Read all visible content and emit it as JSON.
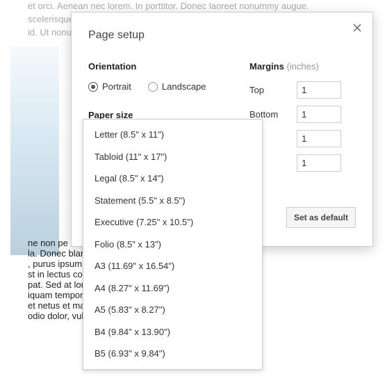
{
  "bg": {
    "line1": "et orci. Aenean nec lorem. In porttitor. Donec laoreet nonummy augue.",
    "line2": "scelerisque",
    "line3": "id. Ut nonur",
    "link1": "ne non pe",
    "link2": "la. Donec blan                                                              rit, felis et",
    "link3": ", purus ipsum p                                                            sl eget",
    "link4": "st in lectus co                                                        dui.",
    "link5": "pat. Sed at lore",
    "link6": "iquam tempor magna. Pellentesque habitant morbi",
    "link7": "et netus et malesuada fames ac turpis egestas. Nunc ac",
    "link8": "odio dolor, vulputate vel, auctor ac, accumsan id, felis."
  },
  "dialog": {
    "title": "Page setup",
    "orientation_label": "Orientation",
    "portrait": "Portrait",
    "landscape": "Landscape",
    "paper_size_label": "Paper size",
    "margins_label": "Margins",
    "margins_unit": " (inches)",
    "margin_top_label": "Top",
    "margin_bottom_label": "Bottom",
    "margin_top": "1",
    "margin_bottom": "1",
    "margin_left": "1",
    "margin_right": "1",
    "set_default": "Set as default"
  },
  "paper_sizes": [
    "Letter (8.5\" x 11\")",
    "Tabloid (11\" x 17\")",
    "Legal (8.5\" x 14\")",
    "Statement (5.5\" x 8.5\")",
    "Executive (7.25\" x 10.5\")",
    "Folio (8.5\" x 13\")",
    "A3 (11.69\" x 16.54\")",
    "A4 (8.27\" x 11.69\")",
    "A5 (5.83\" x 8.27\")",
    "B4 (9.84\" x 13.90\")",
    "B5 (6.93\" x 9.84\")"
  ]
}
